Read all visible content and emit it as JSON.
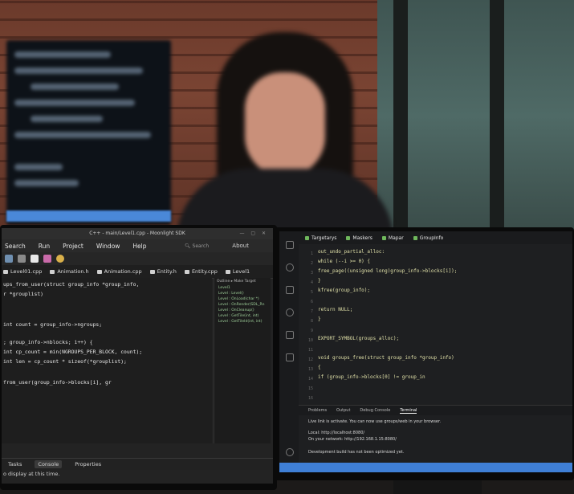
{
  "left_ide": {
    "title": "C++ - main/Level1.cpp - Moonlight SDK",
    "window_controls": "— ▢ ✕",
    "menu": [
      "Search",
      "Run",
      "Project",
      "Window",
      "Help"
    ],
    "search_placeholder": "Search",
    "about": "About",
    "tabs": [
      "Level01.cpp",
      "Animation.h",
      "Animation.cpp",
      "Entity.h",
      "Entity.cpp",
      "Level1"
    ],
    "code_lines": [
      "ups_from_user(struct group_info *group_info,",
      "r *grouplist)",
      "",
      "int count = group_info->ngroups;",
      "",
      "; group_info->nblocks; i++) {",
      "int cp_count = min(NGROUPS_PER_BLOCK, count);",
      "int len = cp_count * sizeof(*grouplist);",
      "",
      "from_user(group_info->blocks[i], gr"
    ],
    "outline_header": "Outline ▸ Make Target",
    "outline_items": [
      "Level1",
      "Level : Level()",
      "Level : OnLoad(char *)",
      "Level : OnRender(SDL_Rn",
      "Level : OnCleanup()",
      "Level : GetTile(int, int)",
      "Level : GetTileId(int, int)"
    ],
    "bottom_tabs": [
      "Tasks",
      "Console",
      "Properties"
    ],
    "console_message": "o display at this time."
  },
  "right_ide": {
    "tabs": [
      "Targetarys",
      "Maskers",
      "Mapar",
      "GroupInfo"
    ],
    "code_lines": [
      "out_undo_partial_alloc:",
      "  while (--i >= 0) {",
      "    free_page((unsigned long)group_info->blocks[i]);",
      "  }",
      "  kfree(group_info);",
      "",
      "  return NULL;",
      "}",
      "",
      "EXPORT_SYMBOL(groups_alloc);",
      "",
      "void groups_free(struct group_info *group_info)",
      "{",
      "  if (group_info->blocks[0] != group_in"
    ],
    "panel_tabs": [
      "Problems",
      "Output",
      "Debug Console",
      "Terminal"
    ],
    "panel_lines": [
      "Live link is activate. You can now use groups/web in your browser.",
      "Local:          http://localhost:8080/",
      "On your network:  http://192.168.1.15:8080/",
      "Development build has not been optimized yet."
    ]
  },
  "colors": {
    "accent_blue": "#3f7fd6",
    "code_green": "#6fb85c",
    "code_yellow": "#e0e0a8"
  }
}
